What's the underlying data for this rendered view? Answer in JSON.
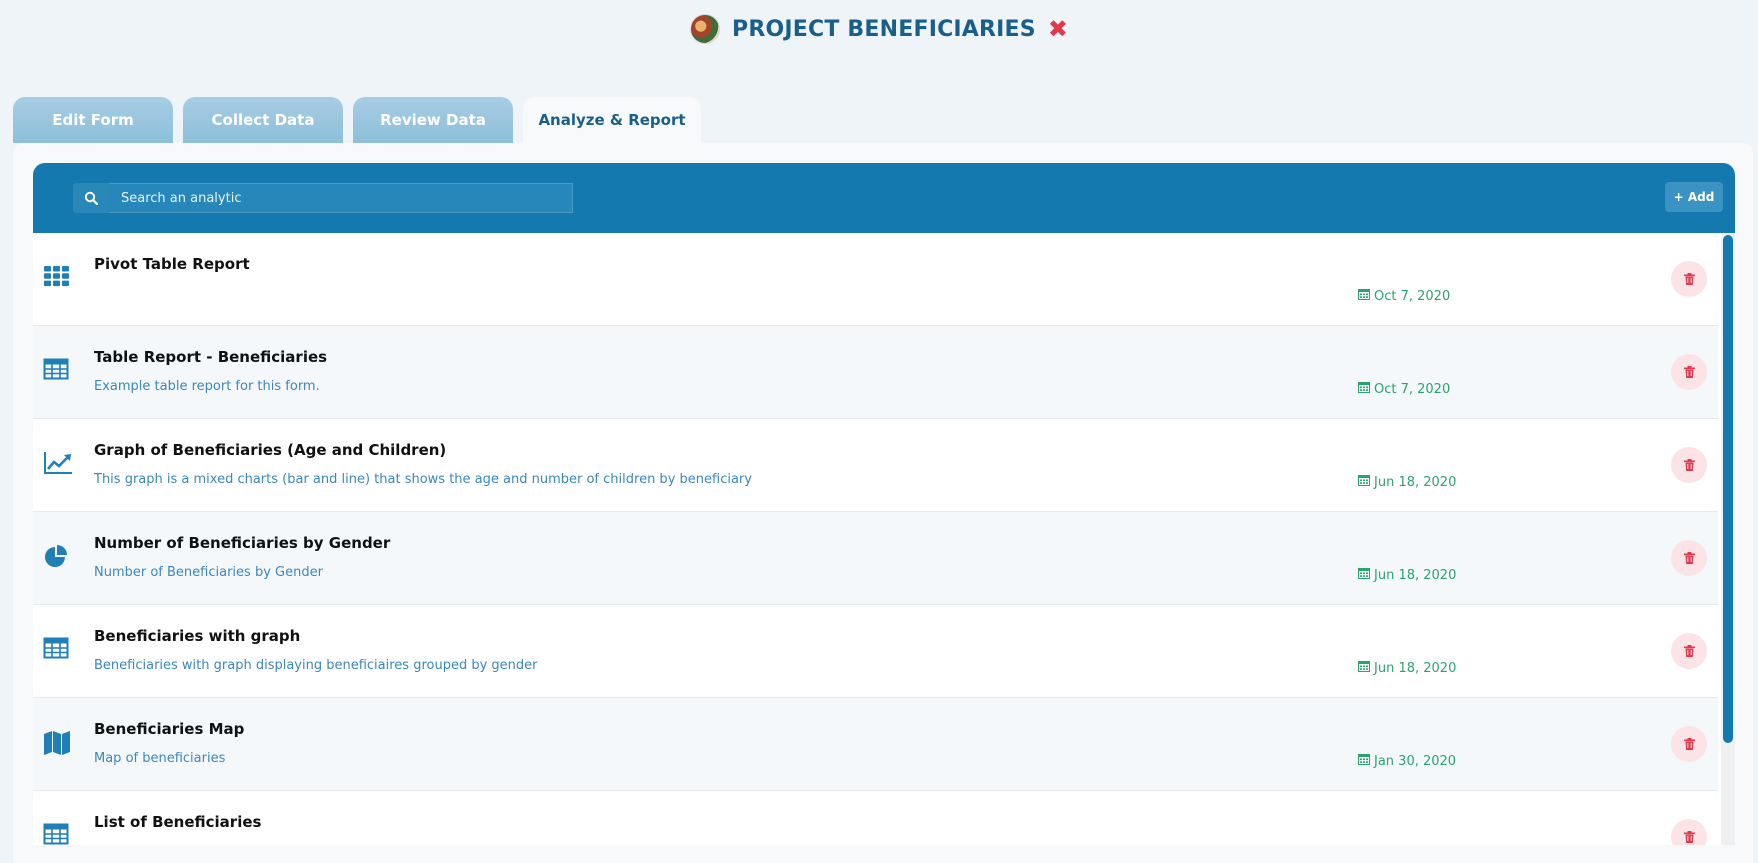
{
  "header": {
    "title": "PROJECT BENEFICIARIES",
    "close_icon": "close-x-icon"
  },
  "tabs": [
    {
      "label": "Edit Form",
      "active": false
    },
    {
      "label": "Collect Data",
      "active": false
    },
    {
      "label": "Review Data",
      "active": false
    },
    {
      "label": "Analyze & Report",
      "active": true
    }
  ],
  "toolbar": {
    "search_placeholder": "Search an analytic",
    "add_label": "+ Add"
  },
  "colors": {
    "accent": "#1479ae",
    "date": "#2aa36f",
    "description": "#3b87bd",
    "delete": "#e0394b"
  },
  "analytics": [
    {
      "icon": "pivot-grid-icon",
      "title": "Pivot Table Report",
      "description": "",
      "date": "Oct 7, 2020"
    },
    {
      "icon": "table-icon",
      "title": "Table Report - Beneficiaries",
      "description": "Example table report for this form.",
      "date": "Oct 7, 2020"
    },
    {
      "icon": "line-chart-icon",
      "title": "Graph of Beneficiaries (Age and Children)",
      "description": "This graph is a mixed charts (bar and line) that shows the age and number of children by beneficiary",
      "date": "Jun 18, 2020"
    },
    {
      "icon": "pie-chart-icon",
      "title": "Number of Beneficiaries by Gender",
      "description": "Number of Beneficiaries by Gender",
      "date": "Jun 18, 2020"
    },
    {
      "icon": "table-icon",
      "title": "Beneficiaries with graph",
      "description": "Beneficiaries with graph displaying beneficiaires grouped by gender",
      "date": "Jun 18, 2020"
    },
    {
      "icon": "map-icon",
      "title": "Beneficiaries Map",
      "description": "Map of beneficiaries",
      "date": "Jan 30, 2020"
    },
    {
      "icon": "table-icon",
      "title": "List of Beneficiaries",
      "description": "",
      "date": ""
    }
  ]
}
